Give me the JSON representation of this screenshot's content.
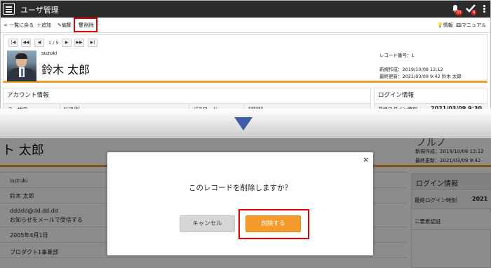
{
  "appbar": {
    "title": "ユーザ管理",
    "bell_badge": "33",
    "check_badge": "6"
  },
  "toolbar": {
    "back_label": "一覧に戻る",
    "add_label": "追加",
    "edit_label": "編集",
    "delete_label": "削除",
    "info_label": "情報",
    "manual_label": "マニュアル"
  },
  "record": {
    "pager": "1 / 5",
    "user_id": "suzuki",
    "user_name": "鈴木 太郎",
    "record_no": "レコード番号：1",
    "created": "新規作成：2019/10/08 12:12",
    "updated": "最終更新：2021/03/09 9:42 鈴木 太郎"
  },
  "account": {
    "title": "アカウント情報",
    "uid_label": "ユーザID",
    "uid_value": "suzuki",
    "pw_label": "パスワード",
    "pw_value": "******"
  },
  "login": {
    "title": "ログイン情報",
    "last_login_label": "最終ログイン時刻",
    "last_login_value": "2021/03/09 9:30"
  },
  "after": {
    "name_partial": "ト 太郎",
    "heading_partial": "ノルノ",
    "created": "新規作成：2019/10/08 12:12",
    "updated": "最終更新：2021/03/09 9:42",
    "rows": [
      "suzuki",
      "鈴木 太郎",
      "ddddd@dd.dd.dd",
      "お知らせをメールで受信する",
      "2005年4月1日",
      "プロダクト1事業部"
    ],
    "login_title": "ログイン情報",
    "last_login_label": "最終ログイン時刻",
    "last_login_value": "2021",
    "two_factor_label": "二要素認証"
  },
  "dialog": {
    "close_glyph": "×",
    "message": "このレコードを削除しますか？",
    "cancel_label": "キャンセル",
    "confirm_label": "削除する"
  },
  "colors": {
    "accent_orange": "#f39a2b",
    "highlight_red": "#e00000",
    "appbar": "#2b2b2b",
    "arrow_blue": "#3e5fa5"
  },
  "icons": [
    "menu-icon",
    "bell-icon",
    "check-icon",
    "kebab-icon",
    "chevron-left-icon",
    "plus-icon",
    "pencil-icon",
    "trash-icon",
    "bulb-icon",
    "book-icon",
    "first-page-icon",
    "prev-10-icon",
    "prev-icon",
    "next-icon",
    "next-10-icon",
    "last-page-icon",
    "down-arrow-icon",
    "close-icon"
  ]
}
